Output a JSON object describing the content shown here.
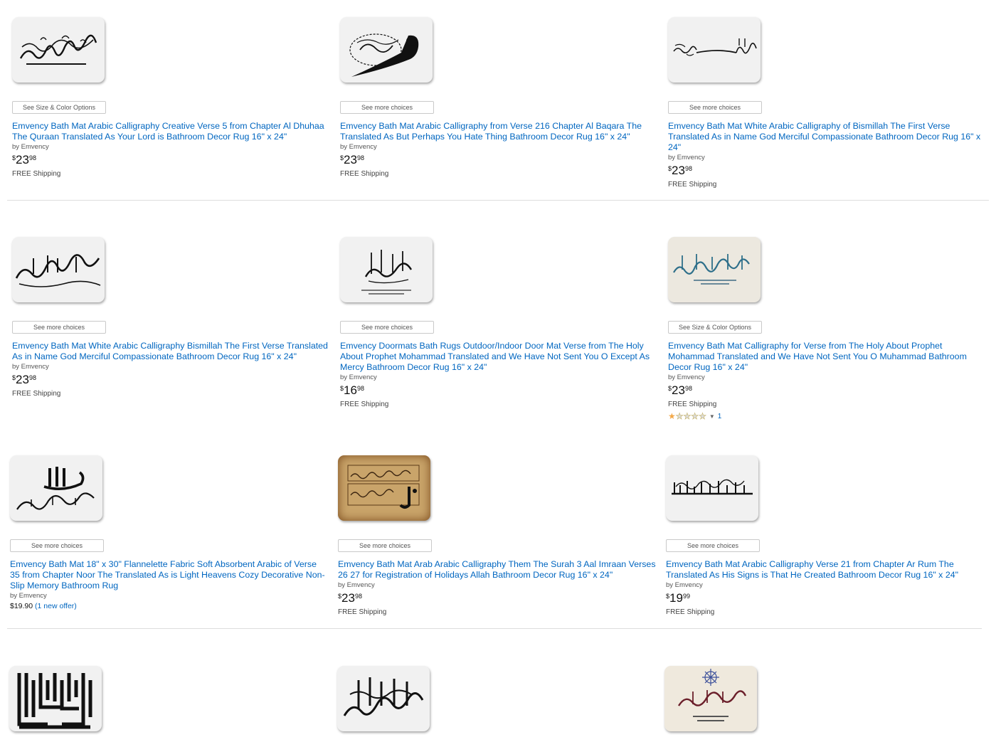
{
  "products": [
    {
      "option_label": "See Size & Color Options",
      "title": "Emvency Bath Mat Arabic Calligraphy Creative Verse 5 from Chapter Al Dhuhaa The Quraan Translated As Your Lord is Bathroom Decor Rug 16\" x 24\"",
      "byline": "by Emvency",
      "price": {
        "currency": "$",
        "whole": "23",
        "fraction": "98"
      },
      "shipping": "FREE Shipping"
    },
    {
      "option_label": "See more choices",
      "title": "Emvency Bath Mat Arabic Calligraphy from Verse 216 Chapter Al Baqara The Translated As But Perhaps You Hate Thing Bathroom Decor Rug 16\" x 24\"",
      "byline": "by Emvency",
      "price": {
        "currency": "$",
        "whole": "23",
        "fraction": "98"
      },
      "shipping": "FREE Shipping"
    },
    {
      "option_label": "See more choices",
      "title": "Emvency Bath Mat White Arabic Calligraphy of Bismillah The First Verse Translated As in Name God Merciful Compassionate Bathroom Decor Rug 16\" x 24\"",
      "byline": "by Emvency",
      "price": {
        "currency": "$",
        "whole": "23",
        "fraction": "98"
      },
      "shipping": "FREE Shipping"
    },
    {
      "option_label": "See more choices",
      "title": "Emvency Bath Mat White Arabic Calligraphy Bismillah The First Verse Translated As in Name God Merciful Compassionate Bathroom Decor Rug 16\" x 24\"",
      "byline": "by Emvency",
      "price": {
        "currency": "$",
        "whole": "23",
        "fraction": "98"
      },
      "shipping": "FREE Shipping"
    },
    {
      "option_label": "See more choices",
      "title": "Emvency Doormats Bath Rugs Outdoor/Indoor Door Mat Verse from The Holy About Prophet Mohammad Translated and We Have Not Sent You O Except As Mercy Bathroom Decor Rug 16\" x 24\"",
      "byline": "by Emvency",
      "price": {
        "currency": "$",
        "whole": "16",
        "fraction": "98"
      },
      "shipping": "FREE Shipping"
    },
    {
      "option_label": "See Size & Color Options",
      "title": "Emvency Bath Mat Calligraphy for Verse from The Holy About Prophet Mohammad Translated and We Have Not Sent You O Muhammad Bathroom Decor Rug 16\" x 24\"",
      "byline": "by Emvency",
      "price": {
        "currency": "$",
        "whole": "23",
        "fraction": "98"
      },
      "shipping": "FREE Shipping",
      "rating": {
        "stars": 1,
        "max": 5,
        "count": "1"
      }
    },
    {
      "option_label": "See more choices",
      "title": "Emvency Bath Mat 18\" x 30\" Flannelette Fabric Soft Absorbent Arabic of Verse 35 from Chapter Noor The Translated As is Light Heavens Cozy Decorative Non-Slip Memory Bathroom Rug",
      "byline": "by Emvency",
      "plain_price": "$19.90",
      "offer_text": "(1 new offer)"
    },
    {
      "option_label": "See more choices",
      "title": "Emvency Bath Mat Arab Arabic Calligraphy Them The Surah 3 Aal Imraan Verses 26 27 for Registration of Holidays Allah Bathroom Decor Rug 16\" x 24\"",
      "byline": "by Emvency",
      "price": {
        "currency": "$",
        "whole": "23",
        "fraction": "98"
      },
      "shipping": "FREE Shipping"
    },
    {
      "option_label": "See more choices",
      "title": "Emvency Bath Mat Arabic Calligraphy Verse 21 from Chapter Ar Rum The Translated As His Signs is That He Created Bathroom Decor Rug 16\" x 24\"",
      "byline": "by Emvency",
      "price": {
        "currency": "$",
        "whole": "19",
        "fraction": "99"
      },
      "shipping": "FREE Shipping"
    }
  ],
  "thumb_colors": {
    "mat_grey": "#f1f1f1",
    "ink": "#111111",
    "teal_ink": "#2e6f8a",
    "parchment": "#c9a46a",
    "parchment_edge": "#7a4a1c",
    "maroon_ink": "#6b1f2a",
    "star_blue": "#3b4f9a"
  }
}
